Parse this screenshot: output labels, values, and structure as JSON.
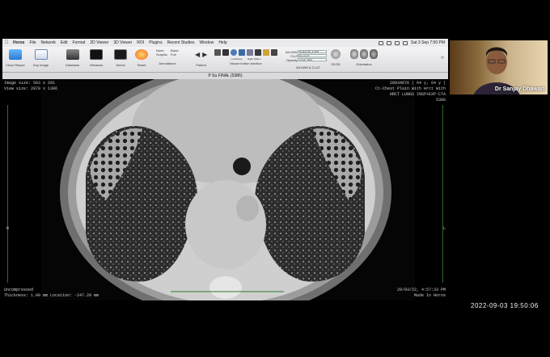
{
  "menubar": {
    "app_name": "Horos",
    "menus": [
      "File",
      "Network",
      "Edit",
      "Format",
      "2D Viewer",
      "3D Viewer",
      "ROI",
      "Plugins",
      "Recent Studies",
      "Window",
      "Help"
    ],
    "clock": "Sat 3 Sep  7:50 PM"
  },
  "toolbar": {
    "cloud_report": "Cloud Report",
    "key_image": "Key Image",
    "database": "Database",
    "windows": "Windows",
    "series": "Series",
    "reset": "Reset",
    "annotations": "Annotations",
    "annot_none": "None",
    "annot_graphic": "Graphic",
    "annot_basic": "Basic",
    "annot_full": "Full",
    "patient": "Patient",
    "left_button": "Left Button",
    "right_button": "Right Button",
    "mouse_button_function": "Mouse button function",
    "wl_ww_label": "WL/WW",
    "wl_ww_value": "Default WL & WW",
    "clut_label": "CLUT",
    "clut_value": "No CLUT",
    "opacity_label": "Opacity",
    "opacity_value": "Linear Table",
    "wl_group_label": "WL/WW & CLUT",
    "twod_3d": "2D/3D",
    "orientation": "Orientation"
  },
  "viewer": {
    "window_title": "P Su FINAL (5386)",
    "image_size": "Image size: 503 x 291",
    "view_size": "View size: 2878 x 1396",
    "patient_info": "20034676 ( 64 y, 64 y )",
    "study_desc": "Ct-Chest Plain With Hrct With",
    "series_desc": "HRCT LUNGS INSP+EXP-CTA",
    "series_num": "5386",
    "compression": "Uncompressed",
    "thickness": "Thickness: 1.00 mm Location: -247.20 mm",
    "date": "29/03/22, 4:57:33 PM",
    "made_in": "Made In Horos",
    "left_marker": "R",
    "right_marker": "L"
  },
  "webcam": {
    "participant_name": "Dr Sanjay Dhawan"
  },
  "recording_timestamp": "2022-09-03  19:50:06",
  "dock": {
    "apps": [
      "finder-icon",
      "launchpad-icon",
      "safari-icon",
      "chrome-icon",
      "mail-icon",
      "contacts-icon",
      "calendar-icon",
      "notes-icon",
      "reminders-icon",
      "photos-icon",
      "facetime-icon",
      "messages-icon",
      "maps-icon",
      "music-icon",
      "podcasts-icon",
      "tv-icon",
      "appstore-icon",
      "settings-icon",
      "word-icon",
      "excel-icon",
      "powerpoint-icon",
      "teams-icon",
      "zoom-icon",
      "horos-icon",
      "preview-icon",
      "terminal-icon",
      "folder-icon",
      "downloads-icon",
      "trash-icon"
    ],
    "colors": [
      "#3b8fe6",
      "#9aa0a8",
      "#2d8cf0",
      "#e44d3a",
      "#3d8ef0",
      "#c69a5c",
      "#f2f2f2",
      "#f7d451",
      "#f4f4f4",
      "#f0b040",
      "#36c452",
      "#35c759",
      "#4db84a",
      "#f23d5a",
      "#a84fd8",
      "#222222",
      "#1e86f5",
      "#8e8e93",
      "#2b579a",
      "#217346",
      "#d24726",
      "#4b53bc",
      "#2d8cff",
      "#606060",
      "#5fa7f0",
      "#222222",
      "#4aa3f0",
      "#4aa3f0",
      "#c7c7cc"
    ]
  }
}
